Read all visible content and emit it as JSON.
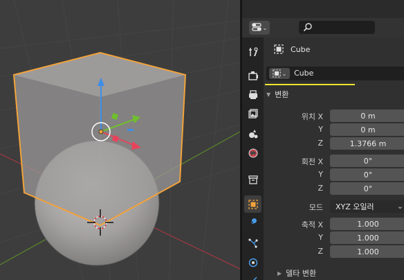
{
  "colors": {
    "viewport_bg": "#3d3d3d",
    "selection_outline": "#f2a33a",
    "axis_x": "#e8435a",
    "axis_y": "#6fbf2e",
    "axis_z": "#3d8ee8",
    "active_highlight": "#f2e52c",
    "panel_bg": "#303030"
  },
  "viewport": {
    "objects": [
      "cube",
      "sphere"
    ],
    "gizmo": "move-gizmo",
    "cursor": "3d-cursor"
  },
  "properties": {
    "header": {
      "editor_icon": "properties-editor-icon",
      "search_placeholder": ""
    },
    "tabs": [
      {
        "name": "tool",
        "icon": "tool-icon"
      },
      {
        "name": "render",
        "icon": "render-icon"
      },
      {
        "name": "output",
        "icon": "output-icon"
      },
      {
        "name": "view-layer",
        "icon": "view-layer-icon"
      },
      {
        "name": "scene",
        "icon": "scene-icon"
      },
      {
        "name": "world",
        "icon": "world-icon"
      },
      {
        "name": "collection",
        "icon": "collection-icon"
      },
      {
        "name": "object",
        "icon": "object-icon",
        "active": true
      },
      {
        "name": "modifiers",
        "icon": "wrench-icon"
      },
      {
        "name": "particles",
        "icon": "particles-icon"
      },
      {
        "name": "physics",
        "icon": "physics-icon"
      },
      {
        "name": "constraints",
        "icon": "constraints-icon"
      }
    ],
    "object_title": "Cube",
    "object_name": "Cube",
    "transform": {
      "title": "변환",
      "location": {
        "label_x": "위치 X",
        "label_y": "Y",
        "label_z": "Z",
        "x": "0 m",
        "y": "0 m",
        "z": "1.3766 m"
      },
      "rotation": {
        "label_x": "회전 X",
        "label_y": "Y",
        "label_z": "Z",
        "x": "0°",
        "y": "0°",
        "z": "0°"
      },
      "mode": {
        "label": "모드",
        "value": "XYZ 오일러"
      },
      "scale": {
        "label_x": "축적 X",
        "label_y": "Y",
        "label_z": "Z",
        "x": "1.000",
        "y": "1.000",
        "z": "1.000"
      },
      "delta": "델타 변환"
    }
  }
}
